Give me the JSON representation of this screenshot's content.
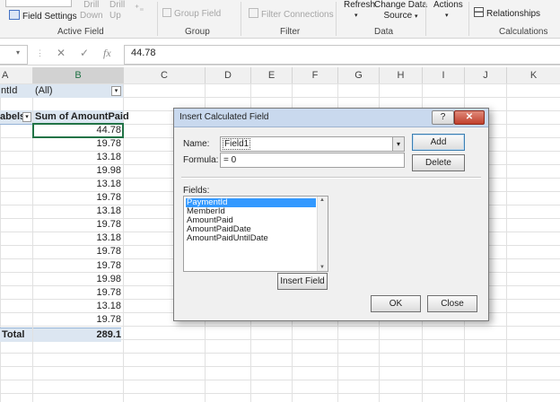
{
  "ribbon": {
    "field_settings": "Field Settings",
    "drill_down": [
      "Drill",
      "Down"
    ],
    "drill_up": [
      "Drill",
      "Up"
    ],
    "group_field": "Group Field",
    "filter_connections": "Filter Connections",
    "refresh": "Refresh",
    "change_data_source": [
      "Change Data",
      "Source"
    ],
    "actions": "Actions",
    "relationships": "Relationships",
    "groups": [
      "Active Field",
      "Group",
      "Filter",
      "Data",
      "Calculations"
    ]
  },
  "formula_bar": {
    "name_box": "",
    "cancel": "✕",
    "enter": "✓",
    "fx": "fx",
    "value": "44.78"
  },
  "columns": [
    "A",
    "B",
    "C",
    "D",
    "E",
    "F",
    "G",
    "H",
    "I",
    "J",
    "K"
  ],
  "sheet": {
    "filter_label": "ntId",
    "filter_value": "(All)",
    "row_labels_header": "abels",
    "sum_header": "Sum of AmountPaid",
    "values": [
      "44.78",
      "19.78",
      "13.18",
      "19.98",
      "13.18",
      "19.78",
      "13.18",
      "19.78",
      "13.18",
      "19.78",
      "19.78",
      "19.98",
      "19.78",
      "13.18",
      "19.78"
    ],
    "total_label": "Total",
    "total_value": "289.1"
  },
  "dialog": {
    "title": "Insert Calculated Field",
    "help": "?",
    "close": "✕",
    "name_label": "Name:",
    "name_value": "Field1",
    "formula_label": "Formula:",
    "formula_value": "= 0",
    "add": "Add",
    "delete": "Delete",
    "fields_label": "Fields:",
    "fields": [
      "PaymentId",
      "MemberId",
      "AmountPaid",
      "AmountPaidDate",
      "AmountPaidUntilDate"
    ],
    "insert_field": "Insert Field",
    "ok": "OK",
    "close_btn": "Close"
  },
  "colors": {
    "excel_green": "#217346",
    "selection_blue": "#3399ff",
    "pivot_header_blue": "#dce6f1"
  }
}
